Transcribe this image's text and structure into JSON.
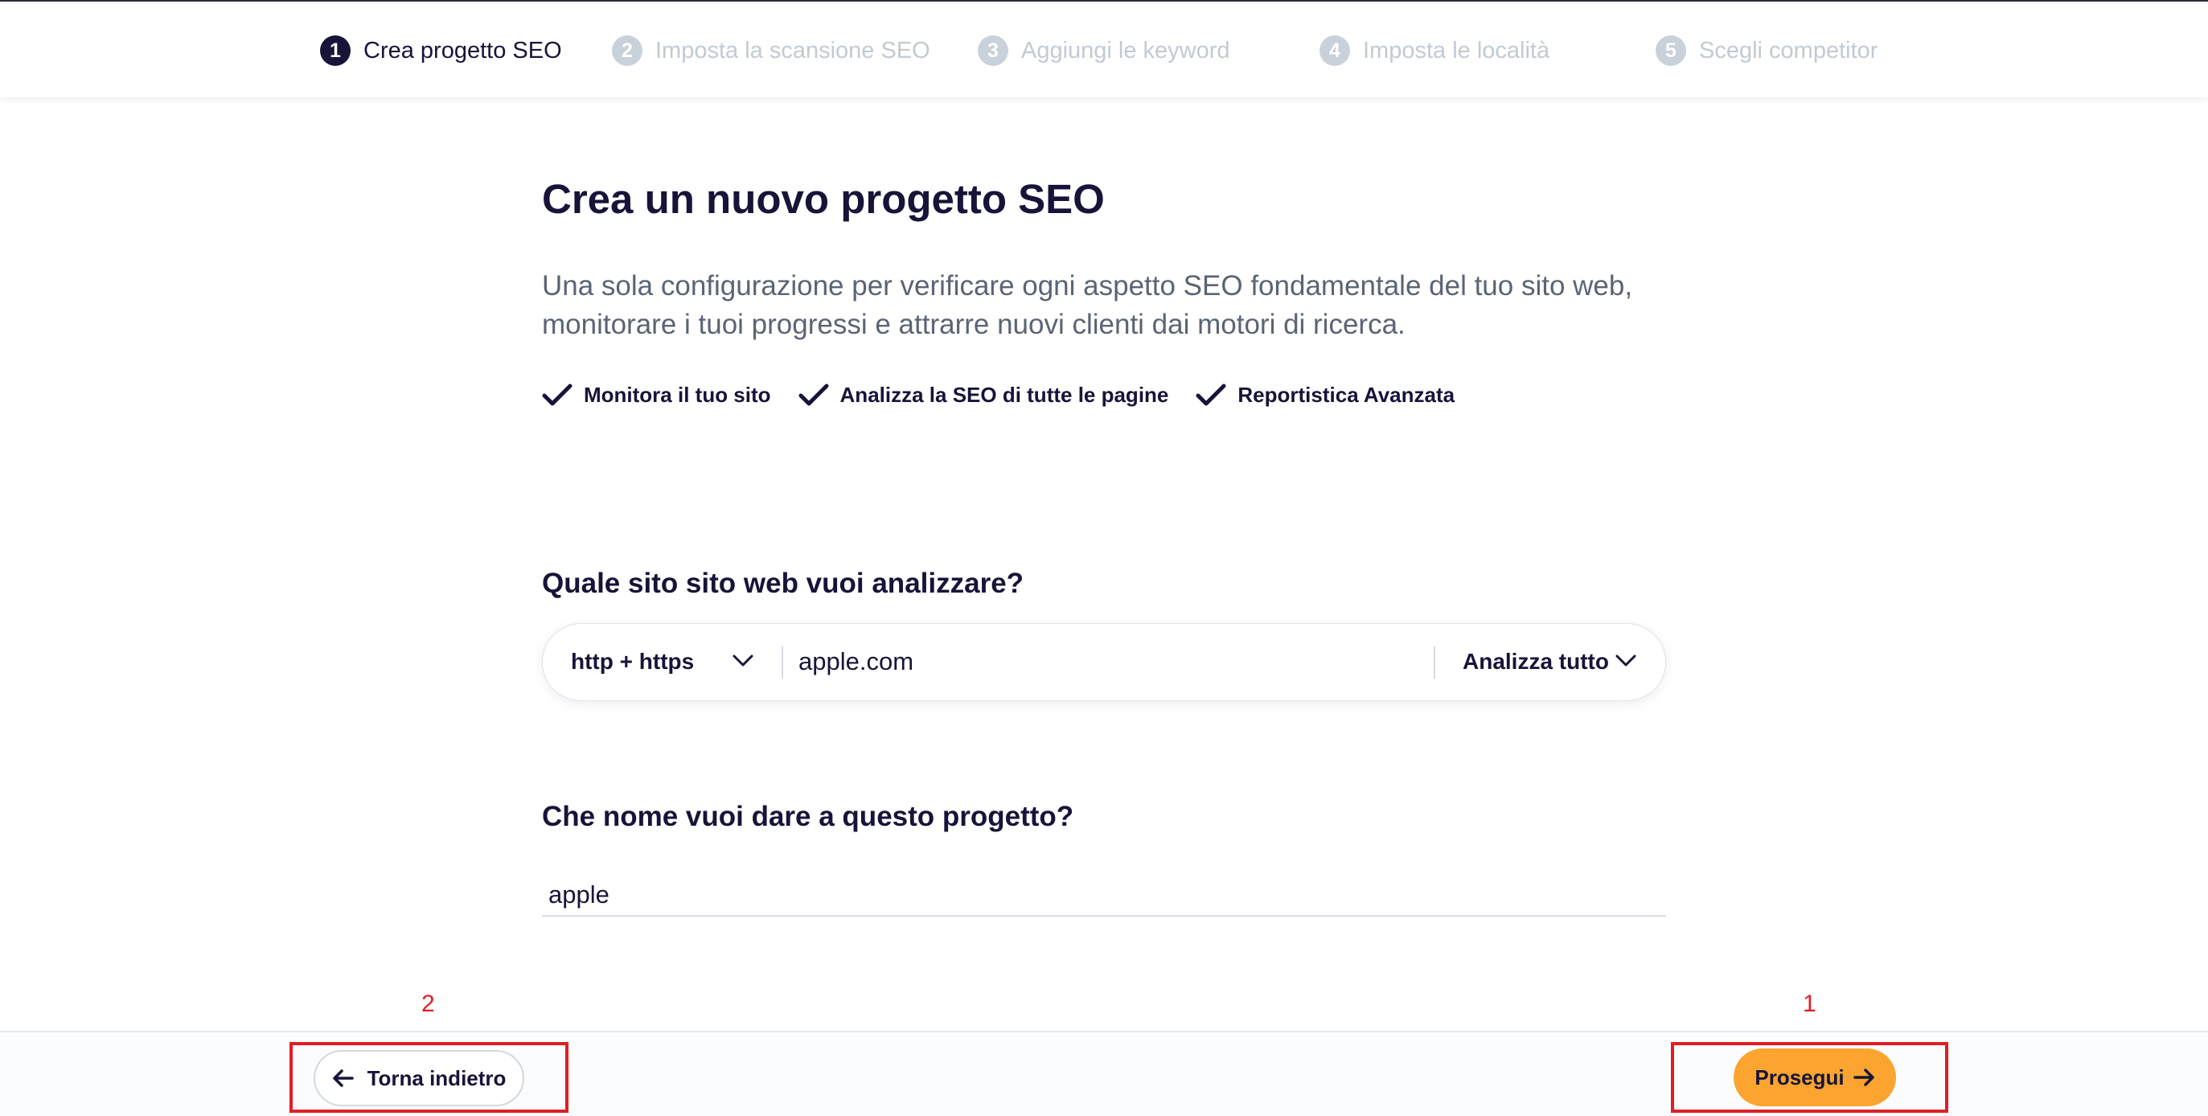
{
  "stepper": {
    "steps": [
      {
        "number": "1",
        "label": "Crea progetto SEO",
        "active": true
      },
      {
        "number": "2",
        "label": "Imposta la scansione SEO",
        "active": false
      },
      {
        "number": "3",
        "label": "Aggiungi le keyword",
        "active": false
      },
      {
        "number": "4",
        "label": "Imposta le località",
        "active": false
      },
      {
        "number": "5",
        "label": "Scegli competitor",
        "active": false
      }
    ]
  },
  "main": {
    "title": "Crea un nuovo progetto SEO",
    "description": "Una sola configurazione per verificare ogni aspetto SEO fondamentale del tuo sito web, monitorare i tuoi progressi e attrarre nuovi clienti dai motori di ricerca.",
    "features": [
      "Monitora il tuo sito",
      "Analizza la SEO di tutte le pagine",
      "Reportistica Avanzata"
    ]
  },
  "website": {
    "question": "Quale sito sito web vuoi analizzare?",
    "protocol": "http + https",
    "url": "apple.com",
    "scope": "Analizza tutto"
  },
  "project": {
    "question": "Che nome vuoi dare a questo progetto?",
    "name": "apple"
  },
  "footer": {
    "back_label": "Torna indietro",
    "next_label": "Prosegui"
  },
  "annotations": {
    "back_marker": "2",
    "next_marker": "1"
  },
  "colors": {
    "primary_text": "#171439",
    "accent": "#fba430",
    "inactive_step": "#c9d1da",
    "marker": "#e01e24"
  }
}
